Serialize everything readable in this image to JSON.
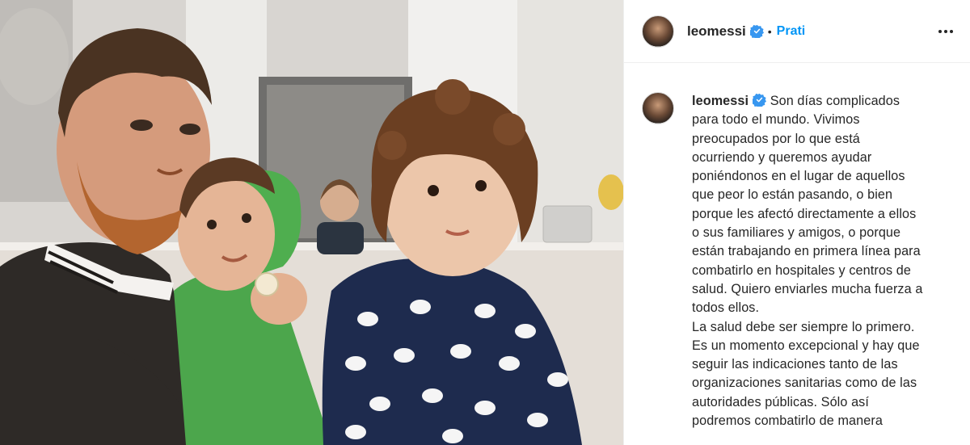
{
  "post": {
    "photo_alt": "Family photo",
    "header": {
      "username": "leomessi",
      "separator": "•",
      "follow_label": "Prati"
    },
    "caption": {
      "username": "leomessi",
      "lines": [
        "Son días complicados",
        "para todo el mundo. Vivimos",
        "preocupados por lo que está",
        "ocurriendo y queremos ayudar",
        "poniéndonos en el lugar de aquellos",
        "que peor lo están pasando, o bien",
        "porque les afectó directamente a ellos",
        "o sus familiares y amigos, o porque",
        "están trabajando en primera línea para",
        "combatirlo en hospitales y centros de",
        "salud. Quiero enviarles mucha fuerza a",
        "todos ellos.",
        "La salud debe ser siempre lo primero.",
        "Es un momento excepcional y hay que",
        "seguir las indicaciones tanto de las",
        "organizaciones sanitarias como de las",
        "autoridades públicas. Sólo así",
        "podremos combatirlo de manera"
      ]
    },
    "icons": {
      "verified": "verified-badge-icon",
      "more": "more-options-icon"
    },
    "colors": {
      "link_blue": "#0095f6",
      "verified_blue": "#3897f0",
      "text": "#262626",
      "border": "#efefef"
    }
  }
}
